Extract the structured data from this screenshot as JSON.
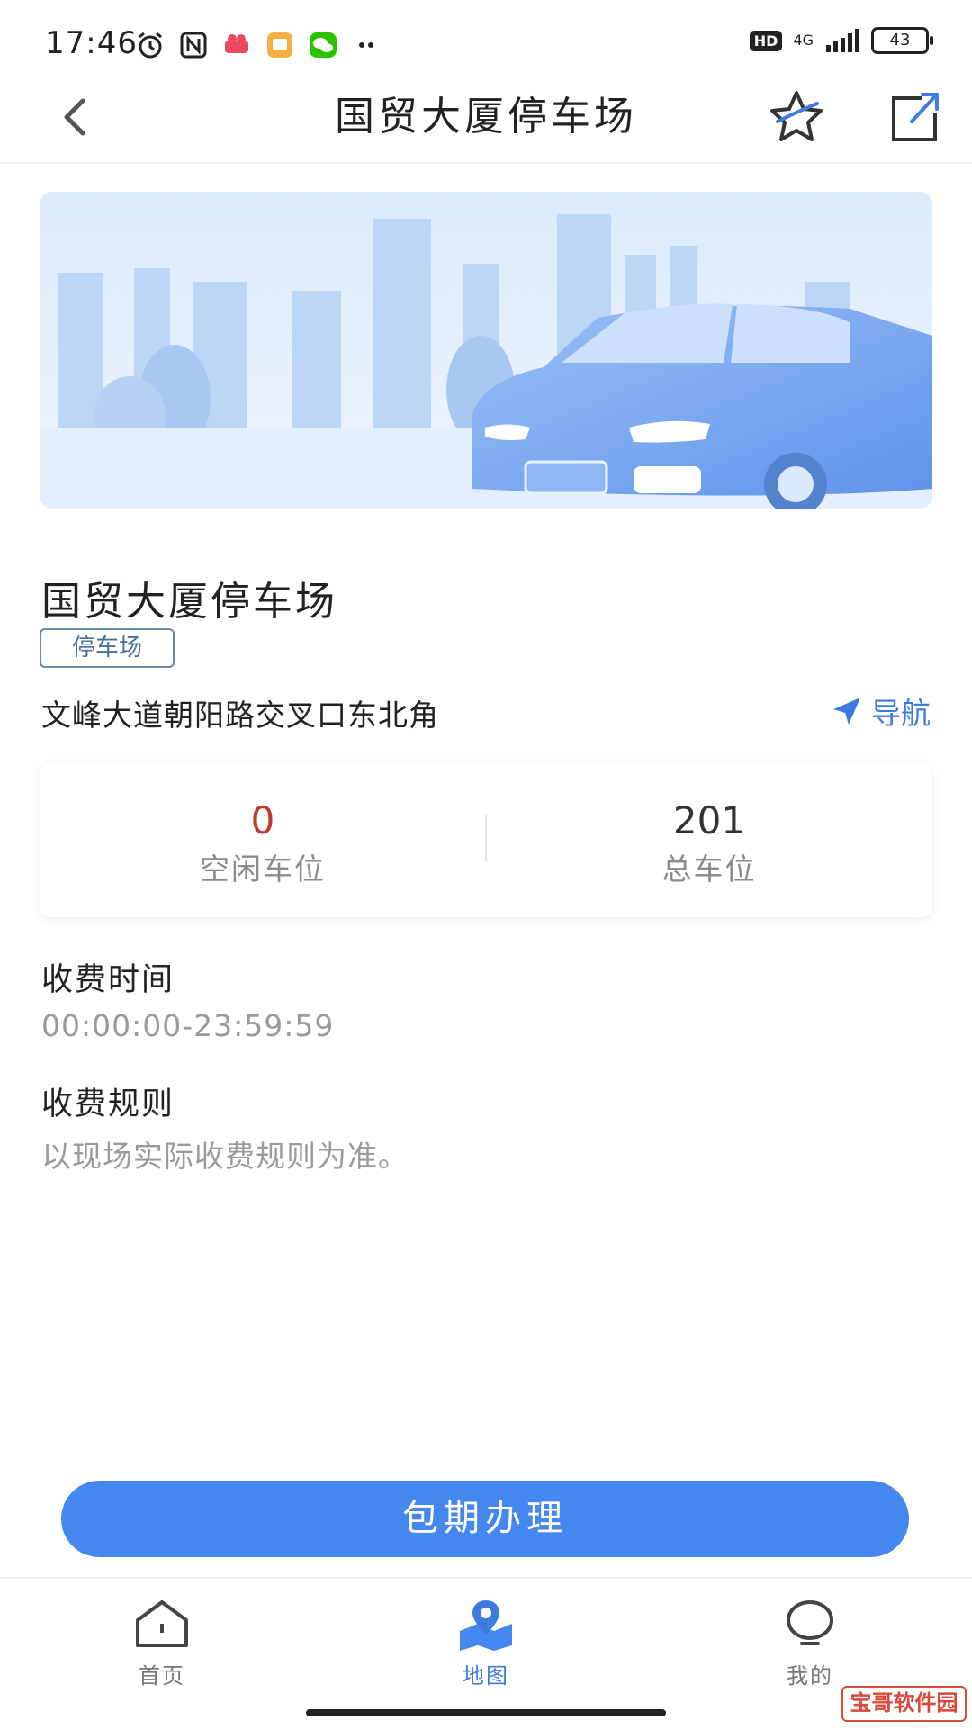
{
  "status_bar": {
    "time": "17:46",
    "network": "4G",
    "badge": "HD",
    "battery": "43"
  },
  "header": {
    "title": "国贸大厦停车场"
  },
  "place": {
    "name": "国贸大厦停车场",
    "tag": "停车场",
    "address": "文峰大道朝阳路交叉口东北角",
    "navigate_label": "导航"
  },
  "stats": {
    "free_count": "0",
    "free_label": "空闲车位",
    "total_count": "201",
    "total_label": "总车位",
    "free_color": "#c0392b"
  },
  "fee_time": {
    "title": "收费时间",
    "value": "00:00:00-23:59:59"
  },
  "fee_rule": {
    "title": "收费规则",
    "value": "以现场实际收费规则为准。"
  },
  "action": {
    "label": "包期办理"
  },
  "tabs": [
    {
      "label": "首页",
      "icon": "home-icon"
    },
    {
      "label": "地图",
      "icon": "map-icon"
    },
    {
      "label": "我的",
      "icon": "profile-icon"
    }
  ],
  "watermark": "宝哥软件园",
  "colors": {
    "accent": "#4487ee",
    "link": "#3d7be0"
  }
}
